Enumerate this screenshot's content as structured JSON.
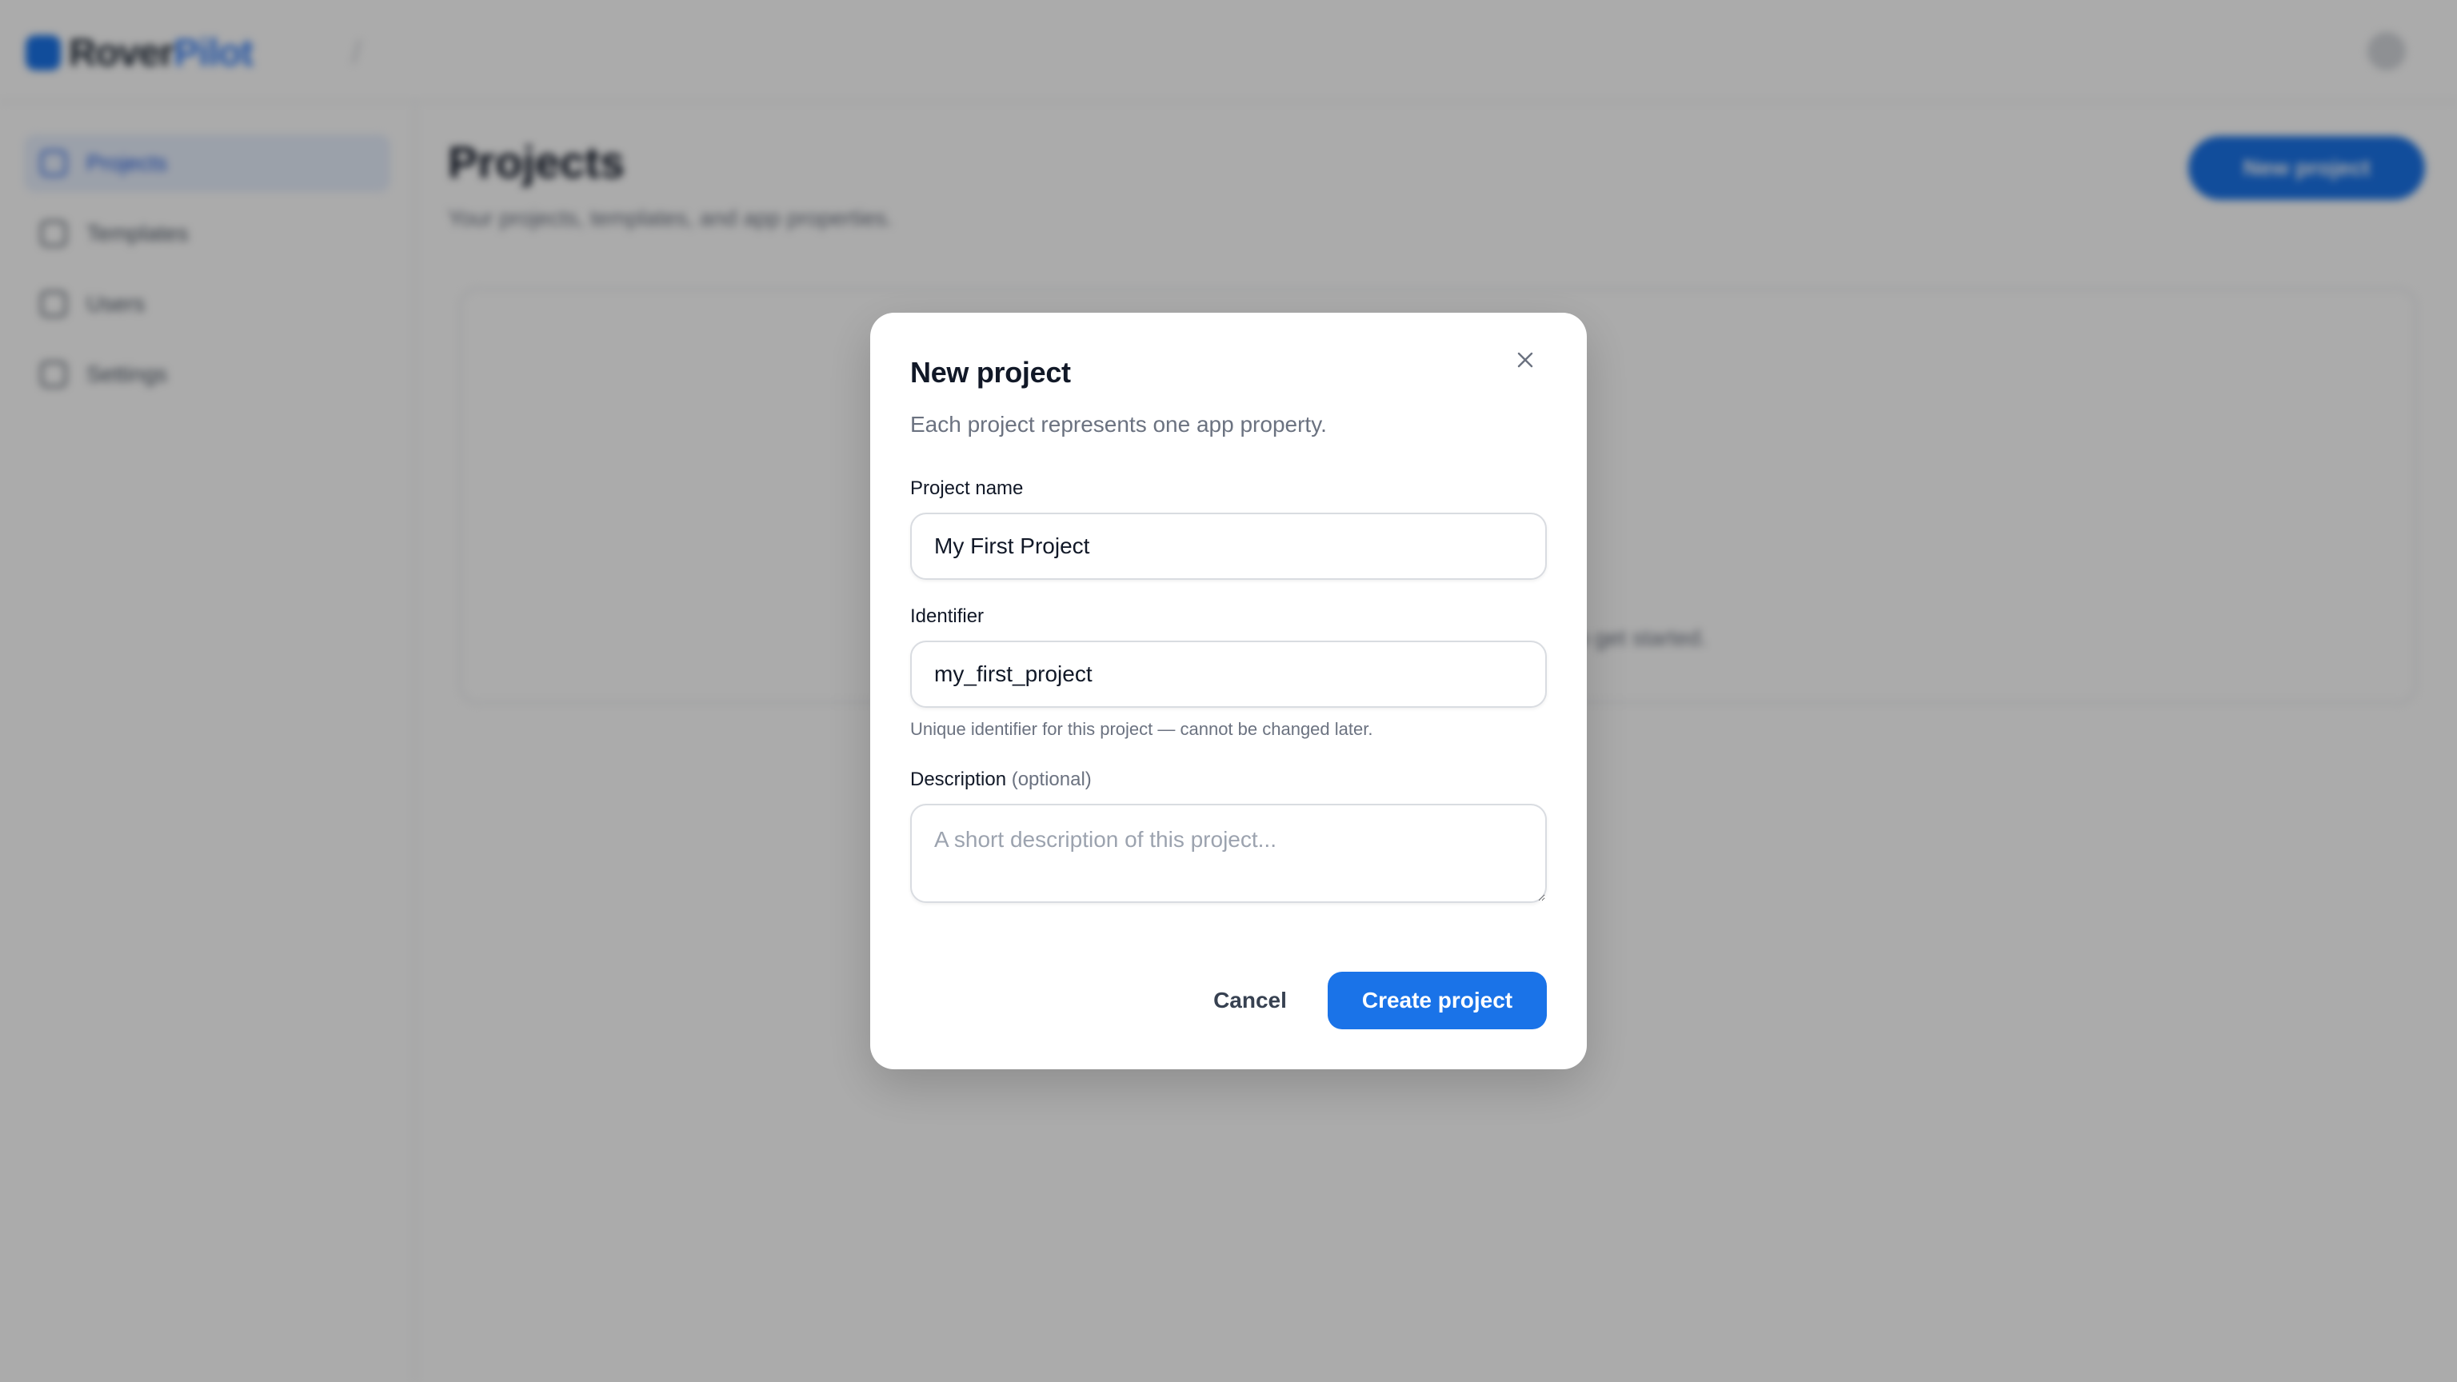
{
  "app": {
    "logo_part1": "Rover",
    "logo_part2": "Pilot",
    "sidebar": {
      "items": [
        {
          "label": "Projects",
          "icon": "folder-icon",
          "active": true
        },
        {
          "label": "Templates",
          "icon": "template-icon",
          "active": false
        },
        {
          "label": "Users",
          "icon": "users-icon",
          "active": false
        },
        {
          "label": "Settings",
          "icon": "gear-icon",
          "active": false
        }
      ]
    },
    "main": {
      "title": "Projects",
      "subtitle": "Your projects, templates, and app properties.",
      "new_button_label": "New project",
      "empty_text": "No projects yet. Create your first project to get started."
    }
  },
  "modal": {
    "title": "New project",
    "subtitle": "Each project represents one app property.",
    "close_icon": "close-icon",
    "fields": {
      "name": {
        "label": "Project name",
        "value": "My First Project"
      },
      "identifier": {
        "label": "Identifier",
        "value": "my_first_project",
        "hint": "Unique identifier for this project — cannot be changed later."
      },
      "description": {
        "label": "Description",
        "optional": "(optional)",
        "value": "",
        "placeholder": "A short description of this project..."
      }
    },
    "cancel_label": "Cancel",
    "create_label": "Create project"
  },
  "colors": {
    "accent": "#1a73e8",
    "overlay": "rgba(0,0,0,0.33)",
    "muted_text": "#6b7280"
  }
}
